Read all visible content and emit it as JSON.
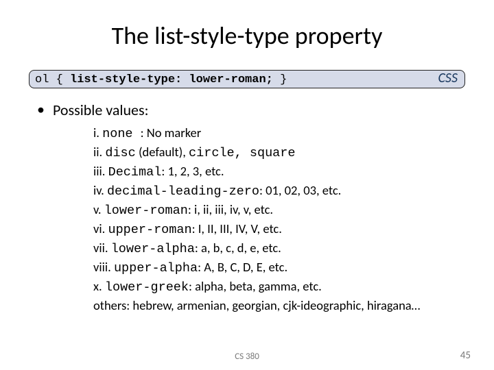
{
  "title": "The list-style-type property",
  "code": {
    "prefix": "ol { ",
    "bold": "list-style-type: lower-roman;",
    "suffix": " }",
    "badge": "CSS"
  },
  "bullet": "Possible values:",
  "items": {
    "i": {
      "marker": "i. ",
      "mono": "none ",
      "rest": ": No marker"
    },
    "ii": {
      "marker": "ii. ",
      "mono": "disc",
      "rest": " (default), ",
      "mono2": "circle, square"
    },
    "iii": {
      "marker": "iii. ",
      "mono": "Decimal",
      "rest": ": 1, 2, 3, etc."
    },
    "iv": {
      "marker": "iv. ",
      "mono": "decimal-leading-zero",
      "rest": ": 01, 02, 03, etc."
    },
    "v": {
      "marker": "v. ",
      "mono": "lower-roman",
      "rest": ": i, ii, iii, iv, v, etc."
    },
    "vi": {
      "marker": "vi. ",
      "mono": "upper-roman",
      "rest": ": I, II, III, IV, V, etc."
    },
    "vii": {
      "marker": "vii. ",
      "mono": "lower-alpha",
      "rest": ": a, b, c, d, e, etc."
    },
    "viii": {
      "marker": "viii. ",
      "mono": "upper-alpha",
      "rest": ": A, B, C, D, E, etc."
    },
    "x": {
      "marker": "x. ",
      "mono": "lower-greek",
      "rest": ": alpha, beta, gamma, etc."
    },
    "others": {
      "text": "others: hebrew, armenian, georgian, cjk-ideographic, hiragana…"
    }
  },
  "footer": {
    "center": "CS 380",
    "right": "45"
  }
}
